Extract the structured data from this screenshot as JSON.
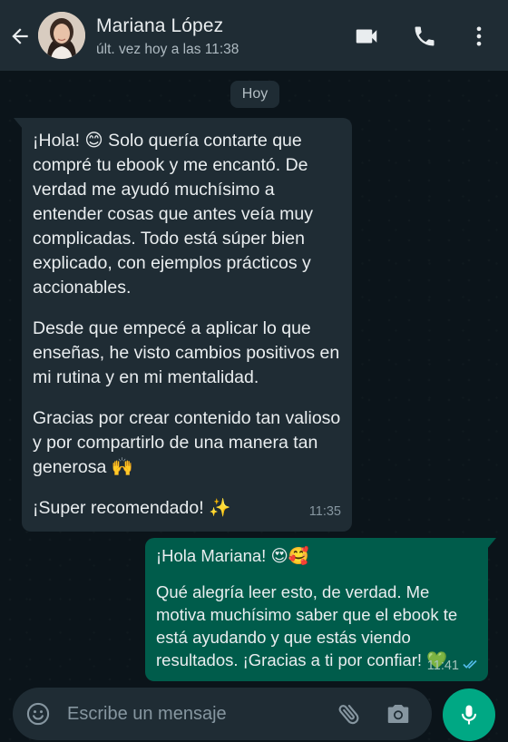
{
  "header": {
    "contact_name": "Mariana López",
    "status": "últ. vez hoy a las 11:38"
  },
  "date_chip": "Hoy",
  "messages": [
    {
      "direction": "incoming",
      "paragraphs": [
        "¡Hola! 😊 Solo quería contarte que compré tu ebook y me encantó. De verdad me ayudó muchísimo a entender cosas que antes veía muy complicadas. Todo está súper bien explicado, con ejemplos prácticos y accionables.",
        "Desde que empecé a aplicar lo que enseñas, he visto cambios positivos en mi rutina y en mi mentalidad.",
        "Gracias por crear contenido tan valioso y por compartirlo de una manera tan generosa 🙌",
        "¡Super recomendado! ✨"
      ],
      "time": "11:35"
    },
    {
      "direction": "outgoing",
      "paragraphs": [
        "¡Hola Mariana! 😍🥰",
        "Qué alegría leer esto, de verdad. Me motiva muchísimo saber que el ebook te está ayudando y que estás viendo resultados. ¡Gracias a ti por confiar! 💚"
      ],
      "time": "11:41",
      "status": "read"
    }
  ],
  "composer": {
    "placeholder": "Escribe un mensaje"
  },
  "icons": {
    "back": "arrow-left-icon",
    "video": "video-camera-icon",
    "phone": "phone-icon",
    "menu": "more-vertical-icon",
    "emoji": "smiley-icon",
    "attach": "paperclip-icon",
    "camera": "camera-icon",
    "mic": "microphone-icon",
    "ticks": "double-check-icon"
  },
  "colors": {
    "header_bg": "#1f2c34",
    "incoming_bubble": "#1f2c34",
    "outgoing_bubble": "#005c4b",
    "accent": "#00a884",
    "read_ticks": "#53bdeb"
  }
}
